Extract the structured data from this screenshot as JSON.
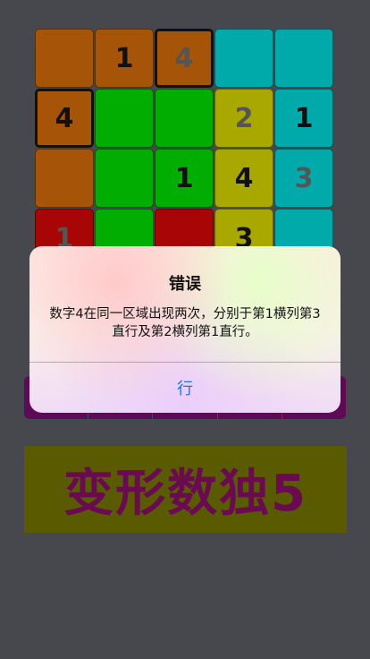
{
  "grid": {
    "rows": [
      [
        {
          "color": "orange",
          "value": "",
          "style": "given",
          "selected": false
        },
        {
          "color": "orange",
          "value": "1",
          "style": "given",
          "selected": false
        },
        {
          "color": "orange",
          "value": "4",
          "style": "entered",
          "selected": true
        },
        {
          "color": "cyan",
          "value": "",
          "style": "given",
          "selected": false
        },
        {
          "color": "cyan",
          "value": "",
          "style": "given",
          "selected": false
        }
      ],
      [
        {
          "color": "orange",
          "value": "4",
          "style": "given",
          "selected": true
        },
        {
          "color": "green",
          "value": "",
          "style": "given",
          "selected": false
        },
        {
          "color": "green",
          "value": "",
          "style": "given",
          "selected": false
        },
        {
          "color": "olive",
          "value": "2",
          "style": "entered",
          "selected": false
        },
        {
          "color": "cyan",
          "value": "1",
          "style": "given",
          "selected": false
        }
      ],
      [
        {
          "color": "orange",
          "value": "",
          "style": "given",
          "selected": false
        },
        {
          "color": "green",
          "value": "",
          "style": "given",
          "selected": false
        },
        {
          "color": "green",
          "value": "1",
          "style": "given",
          "selected": false
        },
        {
          "color": "olive",
          "value": "4",
          "style": "given",
          "selected": false
        },
        {
          "color": "cyan",
          "value": "3",
          "style": "entered",
          "selected": false
        }
      ],
      [
        {
          "color": "red",
          "value": "1",
          "style": "entered",
          "selected": false
        },
        {
          "color": "green",
          "value": "",
          "style": "given",
          "selected": false
        },
        {
          "color": "red",
          "value": "",
          "style": "given",
          "selected": false
        },
        {
          "color": "olive",
          "value": "3",
          "style": "given",
          "selected": false
        },
        {
          "color": "cyan",
          "value": "",
          "style": "given",
          "selected": false
        }
      ]
    ]
  },
  "banner": {
    "title": "变形数独5"
  },
  "alert": {
    "title": "错误",
    "message": "数字4在同一区域出现两次，分别于第1横列第3直行及第2横列第1直行。",
    "ok_label": "行"
  },
  "colors": {
    "background": "#46484d",
    "keypad": "#5e0a56",
    "banner_bg": "#5a5a00",
    "banner_text": "#6a0a50",
    "alert_button": "#1a73e8"
  }
}
